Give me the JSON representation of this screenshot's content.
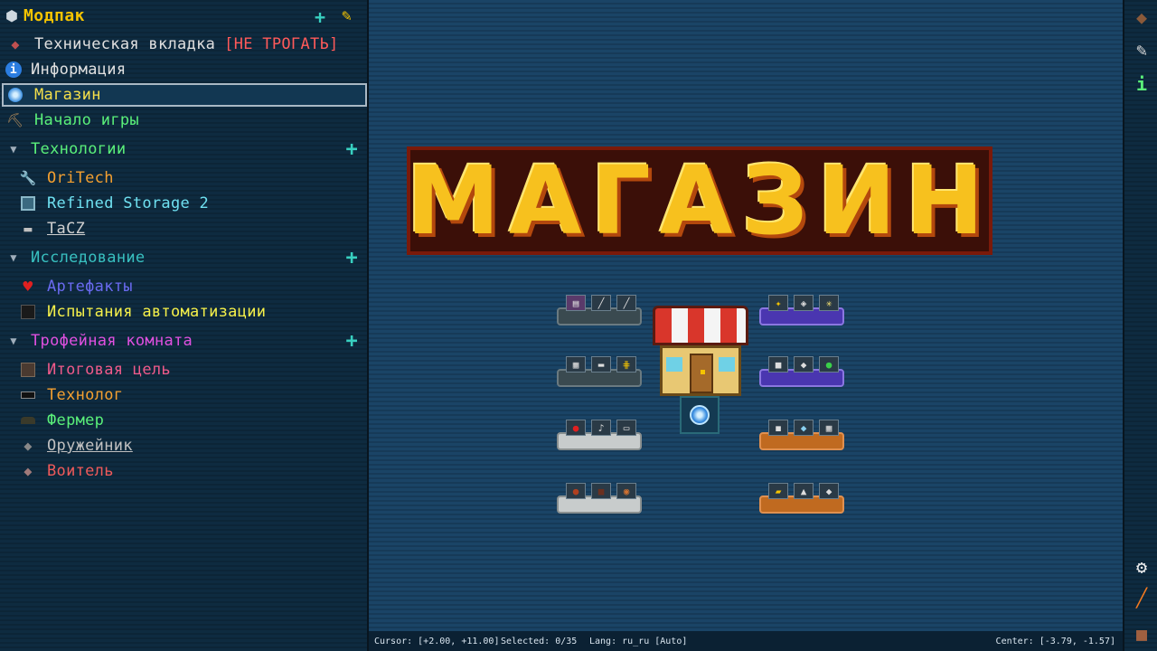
{
  "sidebar": {
    "pack_title": "Модпак",
    "items": [
      {
        "label": "Техническая вкладка",
        "suffix": "[НЕ ТРОГАТЬ]",
        "color": "#e0e0e0",
        "suffix_color": "#ff5a5a",
        "icon": "book-icon"
      },
      {
        "label": "Информация",
        "color": "#e0e0e0",
        "icon": "info-icon"
      },
      {
        "label": "Магазин",
        "color": "#f5e04a",
        "icon": "orb-icon",
        "selected": true
      },
      {
        "label": "Начало игры",
        "color": "#5af07a",
        "icon": "pickaxe-icon"
      }
    ],
    "groups": [
      {
        "label": "Технологии",
        "color": "#5af07a",
        "children": [
          {
            "label": "OriTech",
            "color": "#f5a030",
            "icon": "wrench-icon"
          },
          {
            "label": "Refined Storage 2",
            "color": "#6fe0f0",
            "icon": "storage-block-icon"
          },
          {
            "label": "TaCZ",
            "color": "#d0d0d0",
            "icon": "gun-icon",
            "underline": true
          }
        ]
      },
      {
        "label": "Исследование",
        "color": "#38c0c0",
        "children": [
          {
            "label": "Артефакты",
            "color": "#6a6af0",
            "icon": "heart-icon"
          },
          {
            "label": "Испытания автоматизации",
            "color": "#f5f04a",
            "icon": "block-icon"
          }
        ]
      },
      {
        "label": "Трофейная комната",
        "color": "#e050e0",
        "children": [
          {
            "label": "Итоговая цель",
            "color": "#f05a8a",
            "icon": "crate-icon"
          },
          {
            "label": "Технолог",
            "color": "#f5a030",
            "icon": "mask-icon"
          },
          {
            "label": "Фермер",
            "color": "#5af07a",
            "icon": "hat-icon"
          },
          {
            "label": "Оружейник",
            "color": "#c0c0c0",
            "icon": "helmet-icon",
            "underline": true
          },
          {
            "label": "Воитель",
            "color": "#f05a5a",
            "icon": "shield-icon"
          }
        ]
      }
    ]
  },
  "canvas": {
    "title": "МАГАЗИН"
  },
  "status": {
    "cursor": "Cursor: [+2.00, +11.00]",
    "selected": "Selected: 0/35",
    "lang": "Lang: ru_ru [Auto]",
    "center": "Center: [-3.79, -1.57]"
  }
}
